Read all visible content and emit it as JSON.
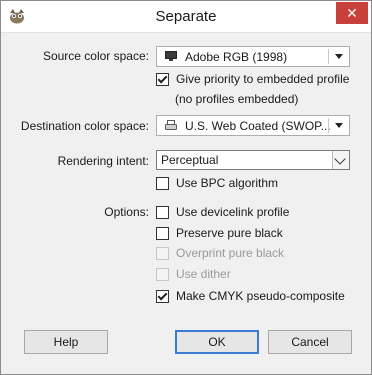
{
  "window": {
    "title": "Separate",
    "close_glyph": "✕"
  },
  "source": {
    "label": "Source color space:",
    "value": "Adobe RGB (1998)",
    "icon": "monitor-icon",
    "priority_label": "Give priority to embedded profile",
    "priority_checked": true,
    "note": "(no profiles embedded)"
  },
  "destination": {
    "label": "Destination color space:",
    "value": "U.S. Web Coated (SWOP...",
    "icon": "printer-icon"
  },
  "rendering": {
    "label": "Rendering intent:",
    "value": "Perceptual",
    "bpc_label": "Use BPC algorithm",
    "bpc_checked": false
  },
  "options": {
    "label": "Options:",
    "items": [
      {
        "label": "Use devicelink profile",
        "checked": false,
        "enabled": true
      },
      {
        "label": "Preserve pure black",
        "checked": false,
        "enabled": true
      },
      {
        "label": "Overprint pure black",
        "checked": false,
        "enabled": false
      },
      {
        "label": "Use dither",
        "checked": false,
        "enabled": false
      },
      {
        "label": "Make CMYK pseudo-composite",
        "checked": true,
        "enabled": true
      }
    ]
  },
  "buttons": {
    "help": "Help",
    "ok": "OK",
    "cancel": "Cancel"
  }
}
